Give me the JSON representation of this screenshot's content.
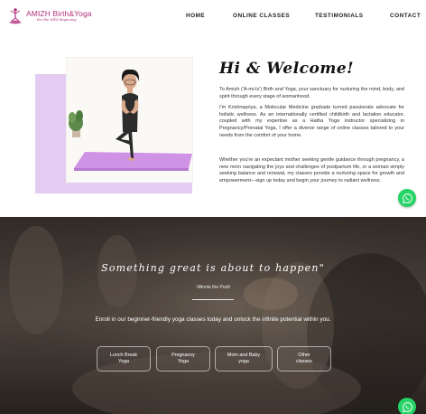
{
  "header": {
    "logo_title": "AMIZH Birth&Yoga",
    "logo_tagline": "For the NEW Beginning",
    "nav": [
      "HOME",
      "ONLINE CLASSES",
      "TESTIMONIALS",
      "CONTACT"
    ]
  },
  "welcome": {
    "title": "Hi & Welcome!",
    "paragraphs": [
      "To Amizh ('A-mi-Iz') Birth and Yoga, your sanctuary for nurturing the mind, body, and spirit through every stage of womanhood.",
      "I'm Krishnapriya, a Molecular Medicine graduate turned passionate advocate for holistic wellness. As an internationally certified childbirth and lactation educator, coupled with my expertise as a Hatha Yoga instructor specializing in Pregnancy/Prenatal Yoga, I offer a diverse range of online classes tailored to your needs from the comfort of your home.",
      "Whether you're an expectant mother seeking gentle guidance through pregnancy, a new mom navigating the joys and challenges of postpartum life, or a woman simply seeking balance and renewal, my classes provide a nurturing space for growth and empowerment—sign up today and begin your journey to radiant wellness."
    ]
  },
  "hero": {
    "quote": "Something great is about to happen\"",
    "author": "-Winnie the Pooh",
    "enroll_text": "Enroll in our beginner-friendly yoga classes today and unlock the infinite potential within you.",
    "classes": [
      {
        "line1": "Lunch Break",
        "line2": "Yoga"
      },
      {
        "line1": "Pregnancy",
        "line2": "Yoga"
      },
      {
        "line1": "Mom and Baby",
        "line2": "yoga"
      },
      {
        "line1": "Other",
        "line2": "classes"
      }
    ]
  },
  "icons": {
    "logo": "lotus-figure-icon",
    "chat": "whatsapp-icon"
  },
  "colors": {
    "brand": "#b0307a",
    "accent_purple": "#e4cbf2",
    "whatsapp": "#25d366"
  }
}
